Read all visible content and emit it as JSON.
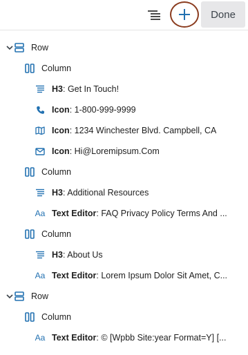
{
  "toolbar": {
    "outline_icon": "list-view-icon",
    "add_icon": "plus-icon",
    "done_label": "Done"
  },
  "tree": {
    "row1": {
      "type": "Row"
    },
    "col1": {
      "type": "Column"
    },
    "h3_1": {
      "type": "H3",
      "text": "Get In Touch!"
    },
    "icon_phone": {
      "type": "Icon",
      "text": "1-800-999-9999"
    },
    "icon_map": {
      "type": "Icon",
      "text": "1234 Winchester Blvd. Campbell, CA"
    },
    "icon_mail": {
      "type": "Icon",
      "text": "Hi@Loremipsum.Com"
    },
    "col2": {
      "type": "Column"
    },
    "h3_2": {
      "type": "H3",
      "text": "Additional Resources"
    },
    "te_1": {
      "type": "Text Editor",
      "text": "FAQ Privacy Policy Terms And ..."
    },
    "col3": {
      "type": "Column"
    },
    "h3_3": {
      "type": "H3",
      "text": "About Us"
    },
    "te_2": {
      "type": "Text Editor",
      "text": "Lorem Ipsum Dolor Sit Amet, C..."
    },
    "row2": {
      "type": "Row"
    },
    "col4": {
      "type": "Column"
    },
    "te_3": {
      "type": "Text Editor",
      "text": "© [Wpbb Site:year Format=Y] [..."
    },
    "aa_glyph": "Aa"
  },
  "colors": {
    "accent": "#2271b1",
    "done_bg": "#e7e7e9",
    "add_ring": "#8a3b1e"
  }
}
